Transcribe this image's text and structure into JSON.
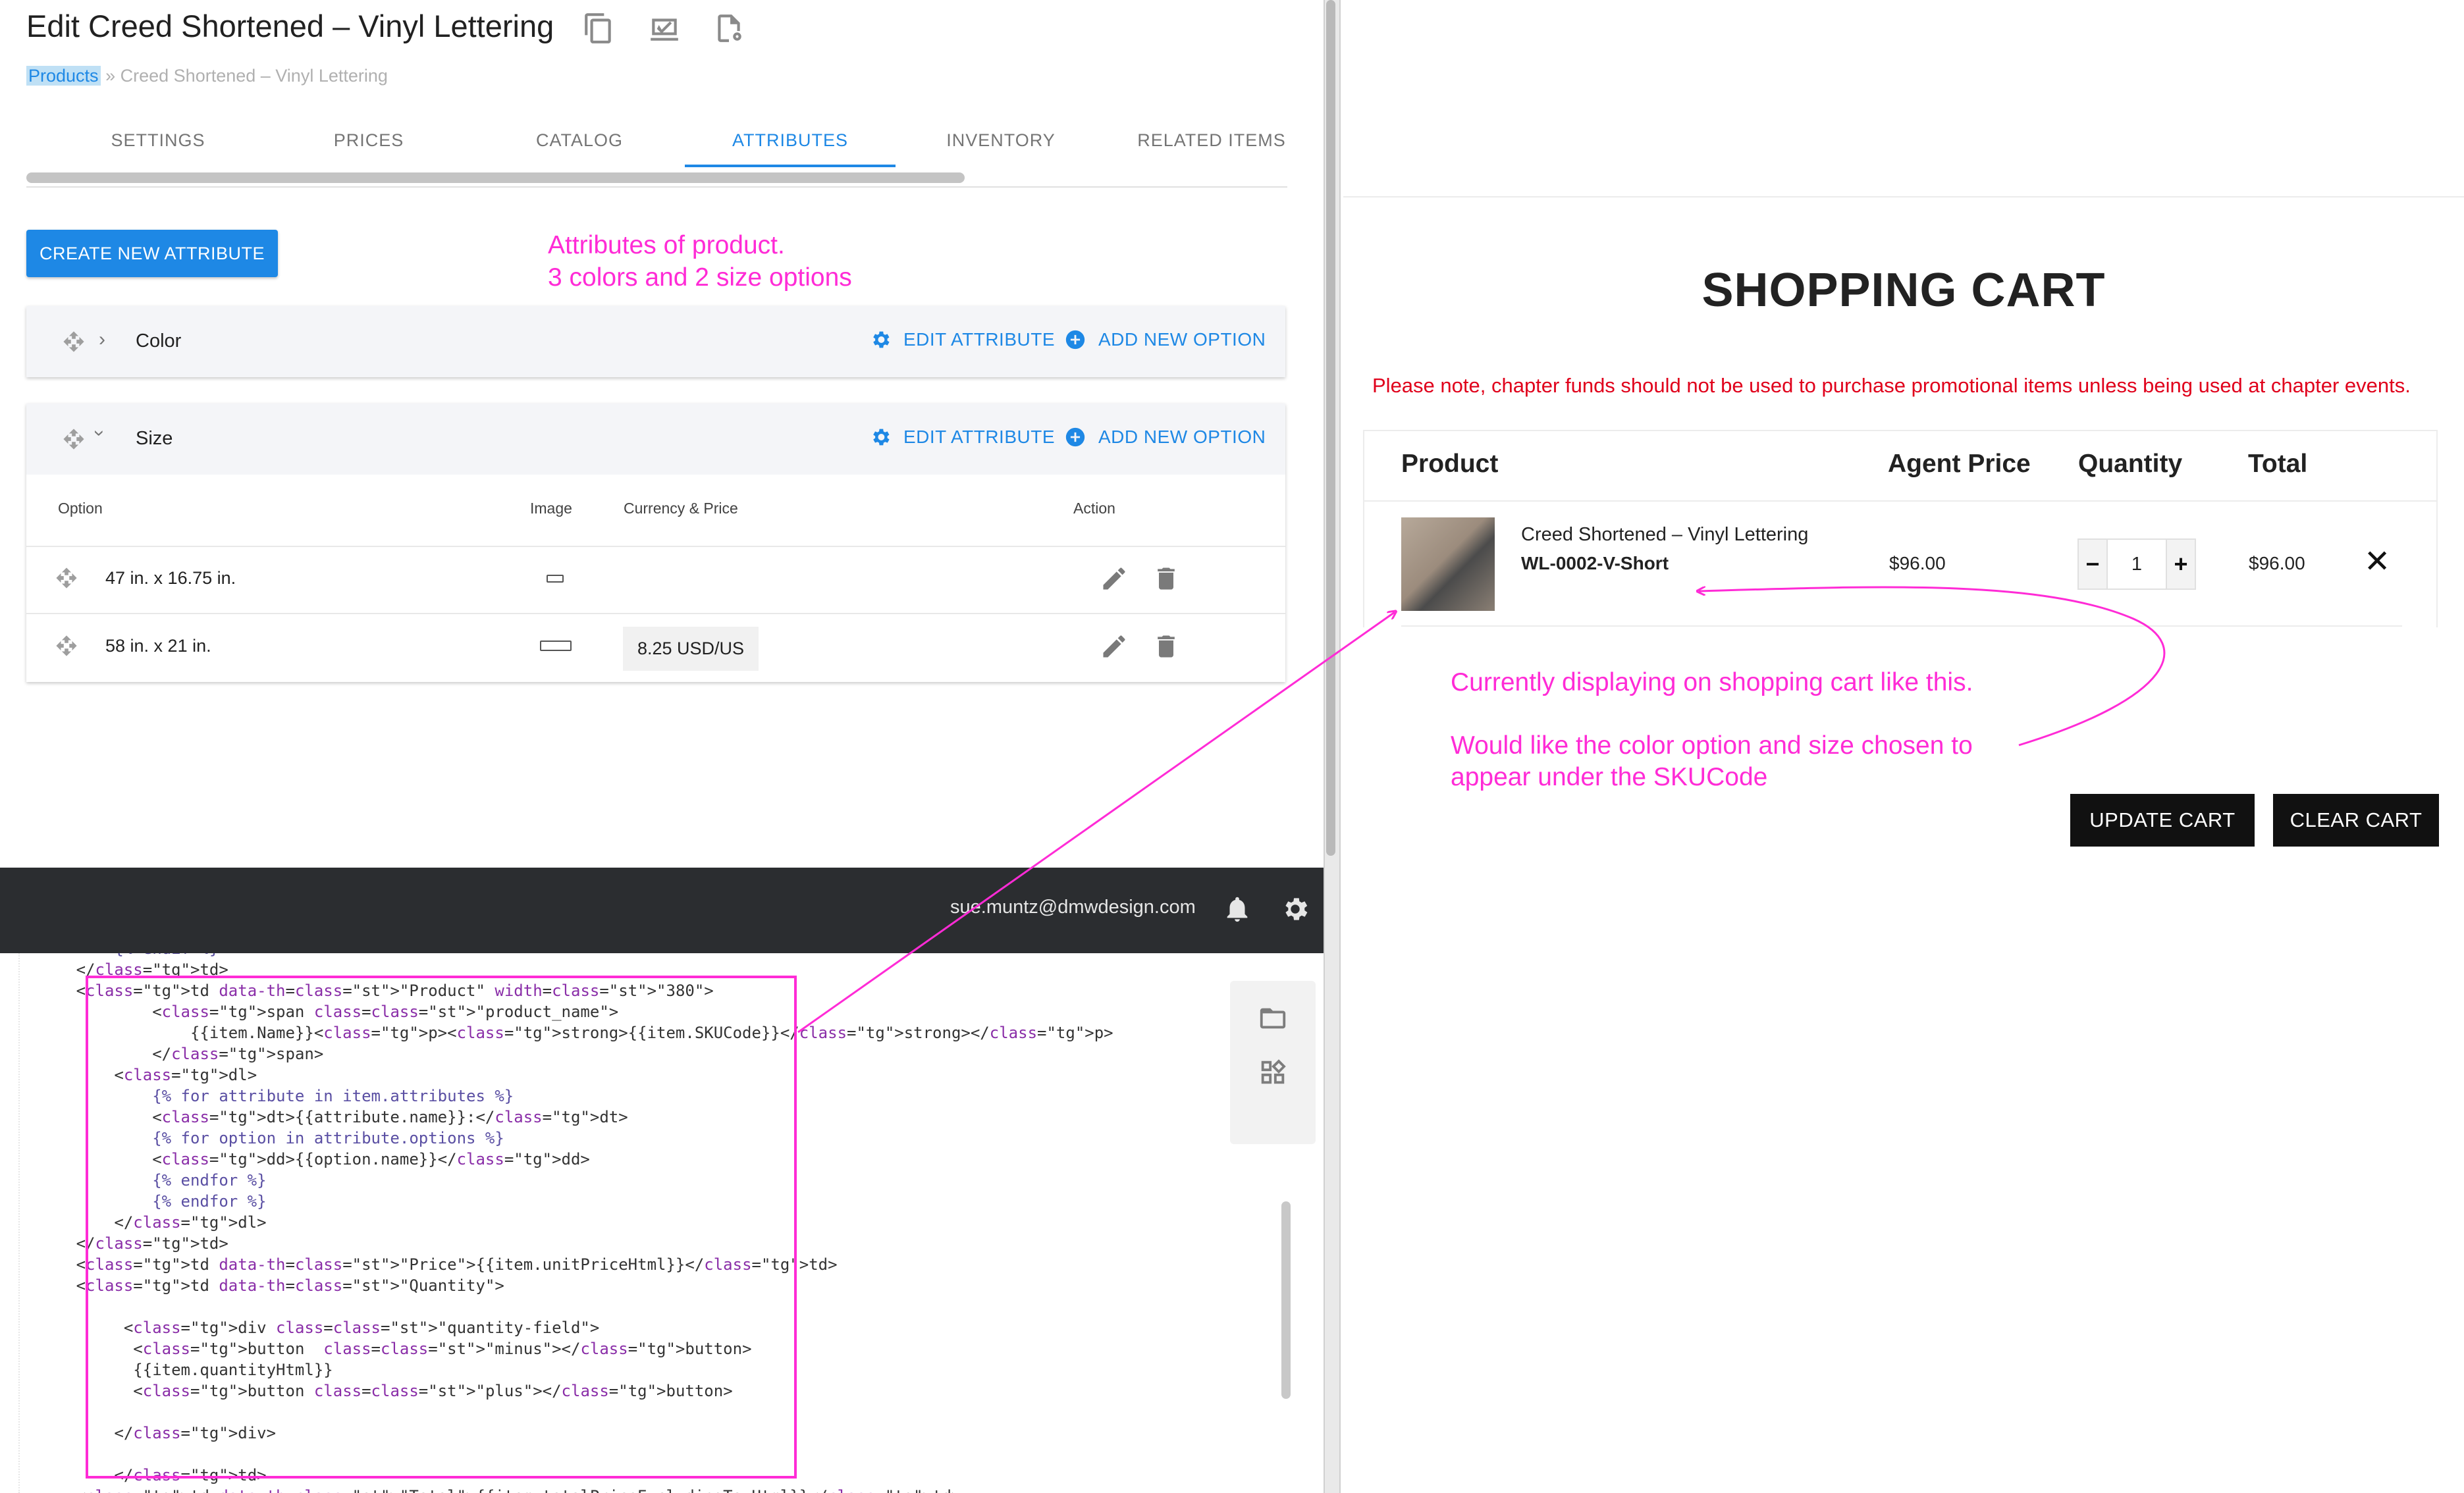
{
  "admin": {
    "title": "Edit Creed Shortened – Vinyl Lettering",
    "title_icons": [
      "copy-icon",
      "preview-icon",
      "file-settings-icon"
    ],
    "breadcrumb": {
      "link": "Products",
      "separator": "»",
      "current": "Creed Shortened – Vinyl Lettering"
    },
    "tabs": [
      "SETTINGS",
      "PRICES",
      "CATALOG",
      "ATTRIBUTES",
      "INVENTORY",
      "RELATED ITEMS"
    ],
    "active_tab": "ATTRIBUTES",
    "create_button": "CREATE NEW ATTRIBUTE",
    "attributes": [
      {
        "name": "Color",
        "edit_label": "EDIT ATTRIBUTE",
        "add_label": "ADD NEW OPTION",
        "expanded": false
      },
      {
        "name": "Size",
        "edit_label": "EDIT ATTRIBUTE",
        "add_label": "ADD NEW OPTION",
        "expanded": true,
        "columns": [
          "Option",
          "Image",
          "Currency & Price",
          "Action"
        ],
        "options": [
          {
            "option": "47 in. x 16.75 in.",
            "price": ""
          },
          {
            "option": "58 in. x 21 in.",
            "price": "8.25 USD/US"
          }
        ]
      }
    ]
  },
  "topbar": {
    "user_email": "sue.muntz@dmwdesign.com"
  },
  "editor": {
    "lines": [
      "            {% endif %}",
      "        </td>",
      "        <td data-th=\"Product\" width=\"380\">",
      "                <span class=\"product_name\">",
      "                    {{item.Name}}<p><strong>{{item.SKUCode}}</strong></p>",
      "                </span>",
      "            <dl>",
      "                {% for attribute in item.attributes %}",
      "                <dt>{{attribute.name}}:</dt>",
      "                {% for option in attribute.options %}",
      "                <dd>{{option.name}}</dd>",
      "                {% endfor %}",
      "                {% endfor %}",
      "            </dl>",
      "        </td>",
      "        <td data-th=\"Price\">{{item.unitPriceHtml}}</td>",
      "        <td data-th=\"Quantity\">",
      "",
      "             <div class=\"quantity-field\">",
      "              <button  class=\"minus\"></button>",
      "              {{item.quantityHtml}}",
      "              <button class=\"plus\"></button>",
      "",
      "            </div>",
      "",
      "            </td>",
      "        <td data-th=\"Total\">{{item.totalPriceExcludingTaxHtml}}</td>"
    ]
  },
  "cart": {
    "title": "SHOPPING CART",
    "note": "Please note, chapter funds should not be used to purchase promotional items unless being used at chapter events.",
    "headers": {
      "product": "Product",
      "agent_price": "Agent Price",
      "quantity": "Quantity",
      "total": "Total"
    },
    "item": {
      "name": "Creed Shortened – Vinyl Lettering",
      "sku": "WL-0002-V-Short",
      "price": "$96.00",
      "quantity": "1",
      "total": "$96.00"
    },
    "update_button": "UPDATE CART",
    "clear_button": "CLEAR CART"
  },
  "annotations": {
    "attributes_note_line1": "Attributes of product.",
    "attributes_note_line2": "3 colors and 2 size options",
    "cart_note_line1": "Currently displaying on shopping cart like this.",
    "cart_note_line2": "Would like the color option and size chosen to",
    "cart_note_line3": "appear under the SKUCode",
    "color": "#ff2bd6"
  },
  "colors": {
    "accent_blue": "#1e88e5",
    "topbar": "#2b2d30",
    "cart_warning": "#e0001b",
    "cart_button": "#111111"
  }
}
